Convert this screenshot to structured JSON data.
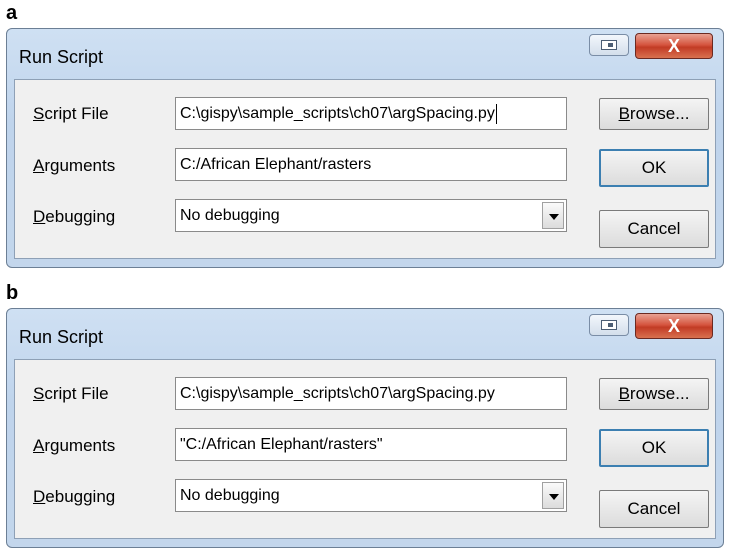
{
  "panels": [
    {
      "label": "a",
      "title": "Run Script",
      "close_glyph": "X",
      "script_file_label": {
        "mnemonic": "S",
        "rest": "cript File"
      },
      "arguments_label": {
        "mnemonic": "A",
        "rest": "rguments"
      },
      "debugging_label": {
        "mnemonic": "D",
        "rest": "ebugging"
      },
      "script_file_value": "C:\\gispy\\sample_scripts\\ch07\\argSpacing.py",
      "arguments_value": "C:/African Elephant/rasters",
      "debugging_value": "No debugging",
      "browse_label": {
        "mnemonic": "B",
        "rest": "rowse..."
      },
      "ok_label": "OK",
      "cancel_label": "Cancel"
    },
    {
      "label": "b",
      "title": "Run Script",
      "close_glyph": "X",
      "script_file_label": {
        "mnemonic": "S",
        "rest": "cript File"
      },
      "arguments_label": {
        "mnemonic": "A",
        "rest": "rguments"
      },
      "debugging_label": {
        "mnemonic": "D",
        "rest": "ebugging"
      },
      "script_file_value": "C:\\gispy\\sample_scripts\\ch07\\argSpacing.py",
      "arguments_value": "\"C:/African Elephant/rasters\"",
      "debugging_value": "No debugging",
      "browse_label": {
        "mnemonic": "B",
        "rest": "rowse..."
      },
      "ok_label": "OK",
      "cancel_label": "Cancel"
    }
  ],
  "icons": {
    "restore": "restore-window-icon",
    "close": "close-icon",
    "dropdown": "chevron-down-icon"
  }
}
